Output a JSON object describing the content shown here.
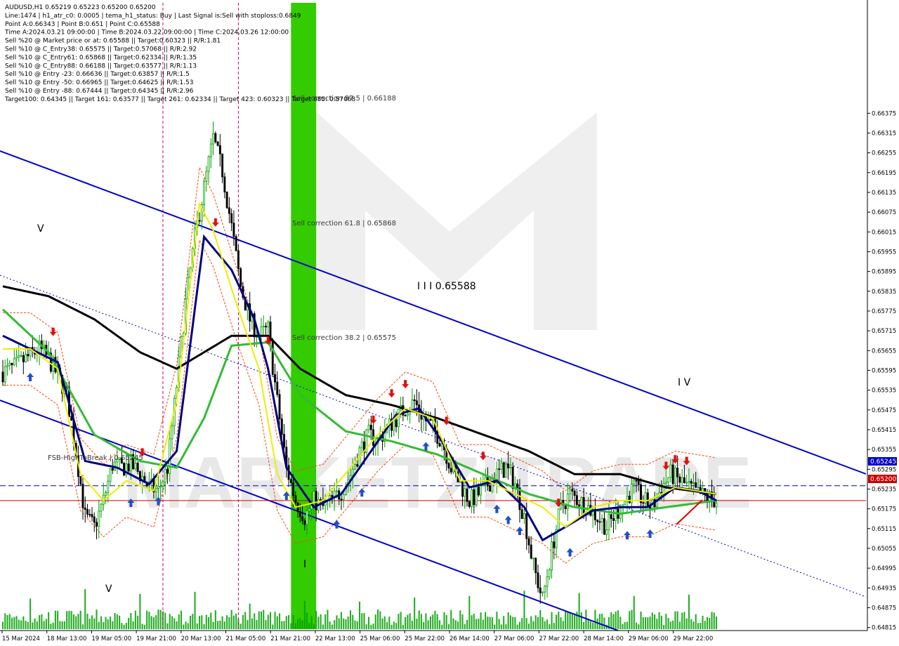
{
  "info_panel": {
    "lines": [
      "AUDUSD,H1  0.65219 0.65223 0.65200 0.65200",
      "Line:1474  |  h1_atr_c0: 0.0005  |  tema_h1_status: Buy  |  Last Signal is:Sell with stoploss:0.6849",
      "Point A:0.66343  |  Point B:0.651  |  Point C:0.65588",
      "Time A:2024.03.21 09:00:00  |  Time B:2024.03.22 09:00:00  |  Time C:2024.03.26 12:00:00",
      "Sell %20 @ Market price or at: 0.65588  ||  Target:0.60323  ||  R/R:1.81",
      "Sell %10 @ C_Entry38: 0.65575  ||  Target:0.57068  ||  R/R:2.92",
      "Sell %10 @ C_Entry61: 0.65868  ||  Target:0.62334  ||  R/R:1.35",
      "Sell %10 @ C_Entry88: 0.66188  ||  Target:0.63577  ||  R/R:1.13",
      "Sell %10 @ Entry -23: 0.66636  ||  Target:0.63857  ||  R/R:1.5",
      "Sell %10 @ Entry -50: 0.66965  ||  Target:0.64625  ||  R/R:1.53",
      "Sell %10 @ Entry -88: 0.67444  ||  Target:0.64345  ||  R/R:2.96",
      "Target100: 0.64345  ||  Target 161: 0.63577  ||  Target 261: 0.62334  ||  Target 423: 0.60323  ||  Target 685: 0.57068"
    ]
  },
  "annotations": {
    "sell_corr_875": "Sell correction 87.5 | 0.66188",
    "sell_corr_618": "Sell correction 61.8 | 0.65868",
    "sell_corr_382": "Sell correction 38.2 | 0.65575",
    "wave_III": "I I I  0.65588",
    "wave_IV": "I V",
    "wave_V": "V",
    "wave_V_low": "V",
    "wave_I": "I",
    "fsb": "FSB-HighToBreak | 0.65245",
    "watermark": "MARKETZITRADE"
  },
  "price_tags": {
    "fsb_value": "0.65245",
    "current_value": "0.65200"
  },
  "colors": {
    "background": "#ffffff",
    "bull_candle": "#00a000",
    "bear_candle": "#000000",
    "channel": "#0000cc",
    "ma_black": "#000000",
    "ma_green": "#33bb33",
    "ma_navy": "#000080",
    "ma_yellow": "#eeee00",
    "orange_envelope": "#ff4500",
    "green_zone": "#33cc00",
    "vline_magenta": "#cc0066",
    "fsb_line": "#0000cc",
    "current_line": "#cc0000",
    "up_arrow": "#1e50c8",
    "down_arrow": "#e01010"
  },
  "chart_data": {
    "type": "candlestick",
    "symbol": "AUDUSD",
    "timeframe": "H1",
    "ohlc_current": {
      "open": 0.65219,
      "high": 0.65223,
      "low": 0.652,
      "close": 0.652
    },
    "ylim": [
      0.6481,
      0.6671
    ],
    "y_ticks": [
      "0.66375",
      "0.66315",
      "0.66255",
      "0.66195",
      "0.66135",
      "0.66075",
      "0.66015",
      "0.65955",
      "0.65895",
      "0.65835",
      "0.65775",
      "0.65715",
      "0.65655",
      "0.65595",
      "0.65535",
      "0.65475",
      "0.65415",
      "0.65355",
      "0.65295",
      "0.65235",
      "0.65175",
      "0.65115",
      "0.65055",
      "0.64995",
      "0.64935",
      "0.64875",
      "0.64815"
    ],
    "x_ticks": [
      "15 Mar 2024",
      "18 Mar 13:00",
      "19 Mar 05:00",
      "19 Mar 21:00",
      "20 Mar 13:00",
      "21 Mar 05:00",
      "21 Mar 21:00",
      "22 Mar 13:00",
      "25 Mar 06:00",
      "25 Mar 22:00",
      "26 Mar 14:00",
      "27 Mar 06:00",
      "27 Mar 22:00",
      "28 Mar 14:00",
      "29 Mar 06:00",
      "29 Mar 22:00"
    ],
    "close_path": [
      [
        0,
        0.6559
      ],
      [
        4,
        0.656
      ],
      [
        8,
        0.6562
      ],
      [
        12,
        0.6564
      ],
      [
        16,
        0.6566
      ],
      [
        20,
        0.6563
      ],
      [
        24,
        0.6558
      ],
      [
        28,
        0.6552
      ],
      [
        32,
        0.6535
      ],
      [
        36,
        0.6515
      ],
      [
        40,
        0.6512
      ],
      [
        44,
        0.652
      ],
      [
        48,
        0.6531
      ],
      [
        52,
        0.653
      ],
      [
        56,
        0.6531
      ],
      [
        60,
        0.6528
      ],
      [
        64,
        0.6524
      ],
      [
        68,
        0.6523
      ],
      [
        72,
        0.653
      ],
      [
        76,
        0.6555
      ],
      [
        80,
        0.658
      ],
      [
        84,
        0.66
      ],
      [
        88,
        0.6615
      ],
      [
        92,
        0.663
      ],
      [
        96,
        0.662
      ],
      [
        100,
        0.6603
      ],
      [
        104,
        0.6585
      ],
      [
        108,
        0.6575
      ],
      [
        112,
        0.657
      ],
      [
        116,
        0.6572
      ],
      [
        120,
        0.655
      ],
      [
        124,
        0.653
      ],
      [
        128,
        0.652
      ],
      [
        132,
        0.6515
      ],
      [
        136,
        0.652
      ],
      [
        140,
        0.6518
      ],
      [
        144,
        0.652
      ],
      [
        148,
        0.6523
      ],
      [
        152,
        0.6528
      ],
      [
        156,
        0.6535
      ],
      [
        160,
        0.654
      ],
      [
        164,
        0.6538
      ],
      [
        168,
        0.6542
      ],
      [
        172,
        0.6545
      ],
      [
        176,
        0.6548
      ],
      [
        180,
        0.655
      ],
      [
        184,
        0.6545
      ],
      [
        188,
        0.6542
      ],
      [
        192,
        0.6538
      ],
      [
        196,
        0.653
      ],
      [
        200,
        0.6525
      ],
      [
        204,
        0.652
      ],
      [
        208,
        0.6522
      ],
      [
        212,
        0.6525
      ],
      [
        216,
        0.6528
      ],
      [
        220,
        0.653
      ],
      [
        224,
        0.6525
      ],
      [
        228,
        0.6515
      ],
      [
        232,
        0.65
      ],
      [
        236,
        0.649
      ],
      [
        240,
        0.6505
      ],
      [
        244,
        0.6518
      ],
      [
        248,
        0.6522
      ],
      [
        252,
        0.652
      ],
      [
        256,
        0.6518
      ],
      [
        260,
        0.6515
      ],
      [
        264,
        0.6512
      ],
      [
        268,
        0.6516
      ],
      [
        272,
        0.652
      ],
      [
        276,
        0.6524
      ],
      [
        280,
        0.652
      ],
      [
        284,
        0.6518
      ],
      [
        288,
        0.6524
      ],
      [
        292,
        0.6528
      ],
      [
        296,
        0.6526
      ],
      [
        300,
        0.6524
      ],
      [
        304,
        0.6522
      ],
      [
        308,
        0.6521
      ],
      [
        312,
        0.652
      ]
    ],
    "series": [
      {
        "name": "MA-black",
        "points": [
          [
            0,
            0.6585
          ],
          [
            20,
            0.6582
          ],
          [
            40,
            0.6575
          ],
          [
            60,
            0.6565
          ],
          [
            76,
            0.656
          ],
          [
            88,
            0.6565
          ],
          [
            100,
            0.657
          ],
          [
            116,
            0.657
          ],
          [
            130,
            0.656
          ],
          [
            150,
            0.6552
          ],
          [
            170,
            0.6549
          ],
          [
            190,
            0.6545
          ],
          [
            210,
            0.654
          ],
          [
            230,
            0.6535
          ],
          [
            250,
            0.6528
          ],
          [
            270,
            0.6528
          ],
          [
            290,
            0.6524
          ],
          [
            312,
            0.6522
          ]
        ]
      },
      {
        "name": "MA-green",
        "points": [
          [
            0,
            0.6578
          ],
          [
            20,
            0.6565
          ],
          [
            40,
            0.654
          ],
          [
            60,
            0.6532
          ],
          [
            76,
            0.653
          ],
          [
            88,
            0.6545
          ],
          [
            100,
            0.6567
          ],
          [
            116,
            0.6568
          ],
          [
            130,
            0.6552
          ],
          [
            150,
            0.6541
          ],
          [
            170,
            0.6538
          ],
          [
            190,
            0.6534
          ],
          [
            210,
            0.6528
          ],
          [
            230,
            0.6522
          ],
          [
            250,
            0.6518
          ],
          [
            270,
            0.6516
          ],
          [
            290,
            0.6518
          ],
          [
            312,
            0.652
          ]
        ]
      },
      {
        "name": "MA-navy",
        "points": [
          [
            0,
            0.657
          ],
          [
            12,
            0.6566
          ],
          [
            24,
            0.6562
          ],
          [
            36,
            0.6532
          ],
          [
            50,
            0.653
          ],
          [
            64,
            0.6525
          ],
          [
            76,
            0.6535
          ],
          [
            88,
            0.66
          ],
          [
            100,
            0.659
          ],
          [
            110,
            0.6575
          ],
          [
            116,
            0.656
          ],
          [
            124,
            0.653
          ],
          [
            136,
            0.6518
          ],
          [
            148,
            0.6522
          ],
          [
            160,
            0.6534
          ],
          [
            172,
            0.6546
          ],
          [
            182,
            0.6548
          ],
          [
            192,
            0.6538
          ],
          [
            204,
            0.6524
          ],
          [
            216,
            0.6526
          ],
          [
            228,
            0.6518
          ],
          [
            236,
            0.6508
          ],
          [
            246,
            0.6512
          ],
          [
            258,
            0.6517
          ],
          [
            270,
            0.6518
          ],
          [
            282,
            0.6518
          ],
          [
            294,
            0.6524
          ],
          [
            304,
            0.6523
          ],
          [
            312,
            0.652
          ]
        ]
      },
      {
        "name": "MA-yellow",
        "points": [
          [
            0,
            0.6566
          ],
          [
            12,
            0.6566
          ],
          [
            24,
            0.656
          ],
          [
            34,
            0.6528
          ],
          [
            44,
            0.652
          ],
          [
            54,
            0.6526
          ],
          [
            66,
            0.6523
          ],
          [
            76,
            0.655
          ],
          [
            86,
            0.661
          ],
          [
            92,
            0.6602
          ],
          [
            102,
            0.658
          ],
          [
            112,
            0.656
          ],
          [
            120,
            0.6528
          ],
          [
            128,
            0.6518
          ],
          [
            140,
            0.652
          ],
          [
            152,
            0.653
          ],
          [
            164,
            0.654
          ],
          [
            176,
            0.6548
          ],
          [
            188,
            0.6545
          ],
          [
            200,
            0.6526
          ],
          [
            212,
            0.6526
          ],
          [
            224,
            0.6522
          ],
          [
            236,
            0.6518
          ],
          [
            246,
            0.6512
          ],
          [
            258,
            0.6518
          ],
          [
            270,
            0.652
          ],
          [
            282,
            0.652
          ],
          [
            294,
            0.6524
          ],
          [
            312,
            0.6522
          ]
        ]
      }
    ],
    "levels": [
      {
        "name": "FSB-HighToBreak",
        "value": 0.65245
      },
      {
        "name": "current",
        "value": 0.652
      }
    ]
  }
}
